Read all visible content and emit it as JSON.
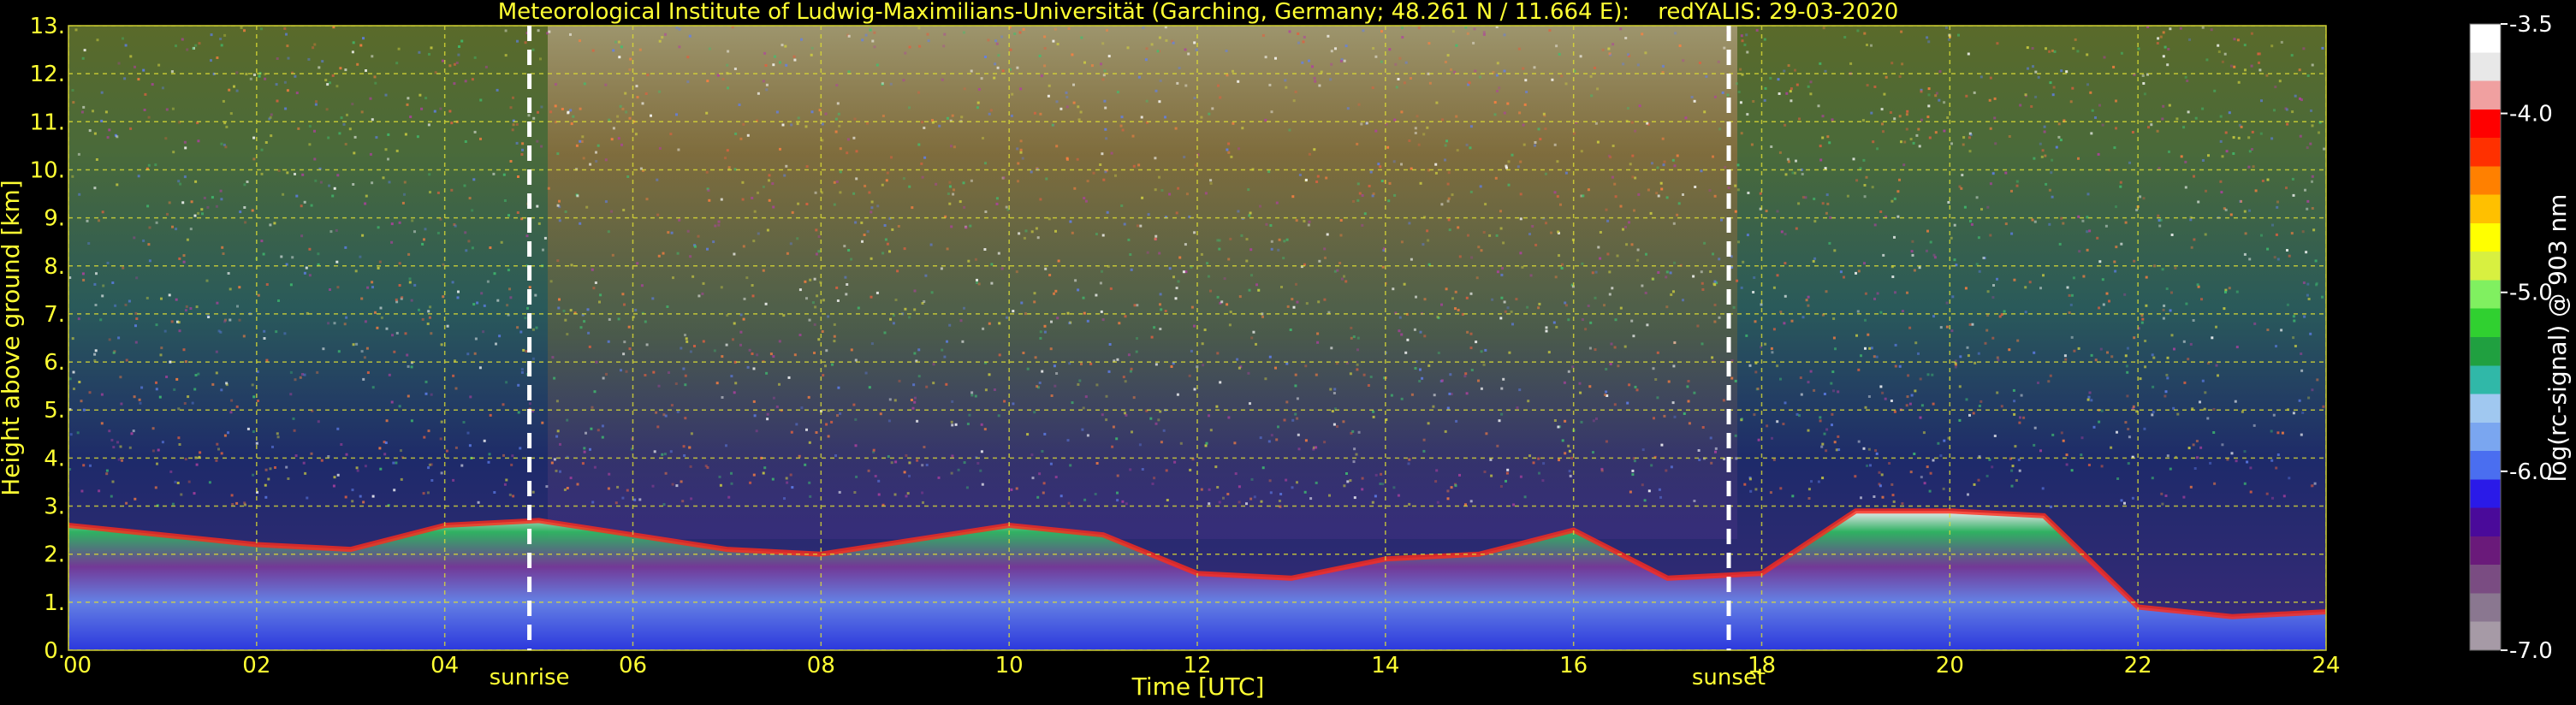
{
  "chart_data": {
    "type": "heatmap",
    "title": "Meteorological Institute of Ludwig-Maximilians-Universität (Garching, Germany; 48.261 N / 11.664 E):    redYALIS: 29-03-2020",
    "xlabel": "Time [UTC]",
    "ylabel": "Height above ground [km]",
    "xlim": [
      0,
      24
    ],
    "ylim": [
      0,
      13
    ],
    "x_ticks": [
      "00",
      "02",
      "04",
      "06",
      "08",
      "10",
      "12",
      "14",
      "16",
      "18",
      "20",
      "22",
      "24"
    ],
    "y_ticks": [
      "0.",
      "1.",
      "2.",
      "3.",
      "4.",
      "5.",
      "6.",
      "7.",
      "8.",
      "9.",
      "10.",
      "11.",
      "12.",
      "13."
    ],
    "grid": true,
    "events": [
      {
        "label": "sunrise",
        "x": 4.9
      },
      {
        "label": "sunset",
        "x": 17.65
      }
    ],
    "colorbar": {
      "label": "log(rc-signal) @ 903 nm",
      "range": [
        -7.0,
        -3.5
      ],
      "ticks": [
        "-3.5",
        "-4.0",
        "-5.0",
        "-6.0",
        "-7.0"
      ],
      "tick_values": [
        -3.5,
        -4.0,
        -5.0,
        -6.0,
        -7.0
      ],
      "colors_low_to_high": [
        "#a69aa6",
        "#8a7790",
        "#7a4c82",
        "#6a1a7a",
        "#4a0a9a",
        "#2a1ae8",
        "#4a6ef0",
        "#7aa6f0",
        "#a0c8f0",
        "#30b8a8",
        "#20a040",
        "#30d030",
        "#80f060",
        "#d8f040",
        "#ffff00",
        "#ffc000",
        "#ff8000",
        "#ff3000",
        "#ff0000",
        "#f0a0a0",
        "#e8e8e8",
        "#ffffff"
      ]
    },
    "boundary_layer_top_km": {
      "time": [
        0,
        2,
        3,
        4,
        5,
        6,
        7,
        8,
        9,
        10,
        11,
        12,
        13,
        14,
        15,
        16,
        17,
        18,
        19,
        20,
        21,
        22,
        23,
        24
      ],
      "height": [
        2.6,
        2.2,
        2.1,
        2.6,
        2.7,
        2.4,
        2.1,
        2.0,
        2.3,
        2.6,
        2.4,
        1.6,
        1.5,
        1.9,
        2.0,
        2.5,
        1.5,
        1.6,
        2.9,
        2.9,
        2.8,
        0.9,
        0.7,
        0.8
      ]
    }
  }
}
